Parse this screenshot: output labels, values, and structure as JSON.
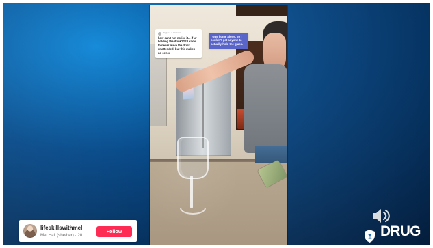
{
  "video": {
    "reply_meta": "Reply to ...'s comment",
    "reply_text": "how can I not notice it... if ur holding the drink??? I know to never leave the drink unattended, but this makes no sense",
    "caption_text": "I was home alone, so I couldn't get anyone to actually hold the glass."
  },
  "profile": {
    "username": "lifeskillswithmel",
    "subtitle": "Mel Hall (she/her) · 20...",
    "follow_label": "Follow"
  },
  "branding": {
    "logo_text": "DRUG"
  },
  "colors": {
    "follow_button": "#fe2c55",
    "caption_bubble": "#5965c8",
    "background_blue": "#0a3f79"
  },
  "icons": {
    "volume": "volume-icon",
    "logo": "drink-shield-icon"
  }
}
